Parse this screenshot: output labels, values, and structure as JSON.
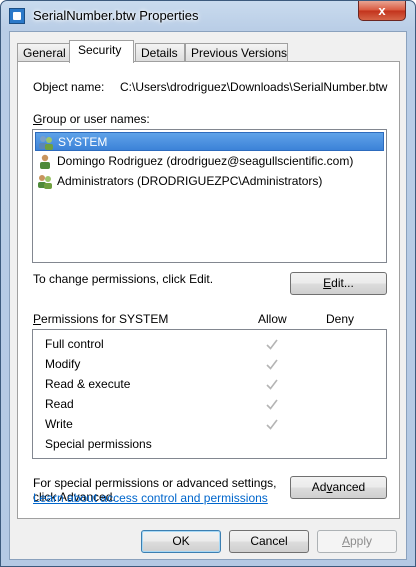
{
  "window": {
    "title": "SerialNumber.btw Properties",
    "close_glyph": "x"
  },
  "tabs": [
    {
      "label": "General"
    },
    {
      "label": "Security"
    },
    {
      "label": "Details"
    },
    {
      "label": "Previous Versions"
    }
  ],
  "object": {
    "label": "Object name:",
    "value": "C:\\Users\\drodriguez\\Downloads\\SerialNumber.btw"
  },
  "groups": {
    "label": "Group or user names:",
    "items": [
      {
        "name": "SYSTEM",
        "icon": "users-group-icon",
        "selected": true
      },
      {
        "name": "Domingo Rodriguez (drodriguez@seagullscientific.com)",
        "icon": "user-icon",
        "selected": false
      },
      {
        "name": "Administrators (DRODRIGUEZPC\\Administrators)",
        "icon": "users-group-icon",
        "selected": false
      }
    ]
  },
  "edit": {
    "hint": "To change permissions, click Edit.",
    "button": "Edit..."
  },
  "permissions": {
    "label": "Permissions for SYSTEM",
    "allow_header": "Allow",
    "deny_header": "Deny",
    "rows": [
      {
        "name": "Full control",
        "allow": true,
        "deny": false
      },
      {
        "name": "Modify",
        "allow": true,
        "deny": false
      },
      {
        "name": "Read & execute",
        "allow": true,
        "deny": false
      },
      {
        "name": "Read",
        "allow": true,
        "deny": false
      },
      {
        "name": "Write",
        "allow": true,
        "deny": false
      },
      {
        "name": "Special permissions",
        "allow": false,
        "deny": false
      }
    ]
  },
  "advanced": {
    "hint_line1": "For special permissions or advanced settings,",
    "hint_line2": "click Advanced.",
    "button": "Advanced"
  },
  "learn_link": "Learn about access control and permissions",
  "footer": {
    "ok": "OK",
    "cancel": "Cancel",
    "apply": "Apply"
  },
  "colors": {
    "selection": "#3c82d8",
    "link": "#0066cc",
    "check": "#b5b5b5"
  }
}
